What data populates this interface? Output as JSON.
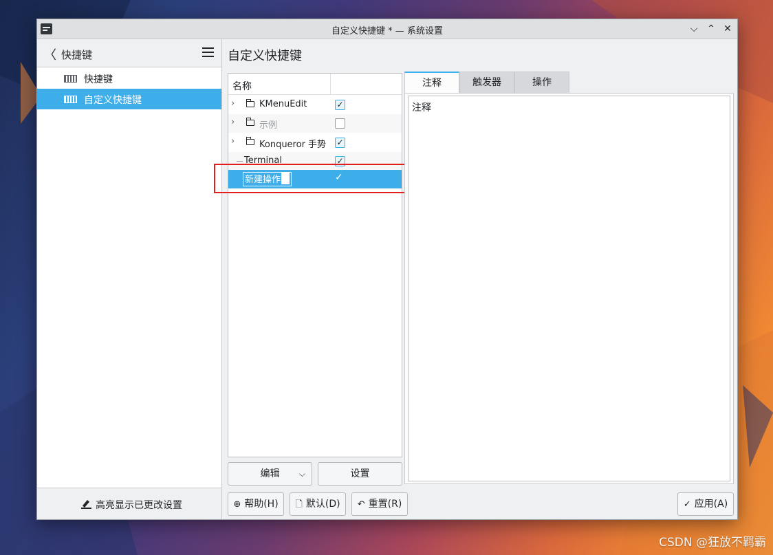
{
  "window": {
    "title": "自定义快捷键 * — 系统设置",
    "controls": {
      "minimize": "⌵",
      "maximize": "⌃",
      "close": "✕"
    }
  },
  "sidebar": {
    "title": "快捷键",
    "items": [
      {
        "label": "快捷键",
        "icon": "keyboard-icon",
        "selected": false
      },
      {
        "label": "自定义快捷键",
        "icon": "keyboard-icon",
        "selected": true
      }
    ],
    "footer_button": "高亮显示已更改设置"
  },
  "main": {
    "title": "自定义快捷键",
    "tree": {
      "column_name": "名称",
      "rows": [
        {
          "label": "KMenuEdit",
          "type": "folder",
          "checked": true
        },
        {
          "label": "示例",
          "type": "folder",
          "checked": false,
          "disabled": true
        },
        {
          "label": "Konqueror 手势",
          "type": "folder",
          "checked": true
        },
        {
          "label": "Terminal",
          "type": "item",
          "checked": true
        },
        {
          "label": "新建操作",
          "type": "item",
          "checked": true,
          "selected": true,
          "editing": true
        }
      ]
    },
    "edit_button": "编辑",
    "settings_button": "设置",
    "tabs": [
      {
        "label": "注释",
        "active": true
      },
      {
        "label": "触发器",
        "active": false
      },
      {
        "label": "操作",
        "active": false
      }
    ],
    "comment_text": "注释"
  },
  "footer": {
    "help": "帮助(H)",
    "defaults": "默认(D)",
    "reset": "重置(R)",
    "apply": "应用(A)"
  },
  "watermark": "CSDN @狂放不羁霸",
  "colors": {
    "accent": "#3daee9",
    "highlight_box": "#e31c1c"
  }
}
